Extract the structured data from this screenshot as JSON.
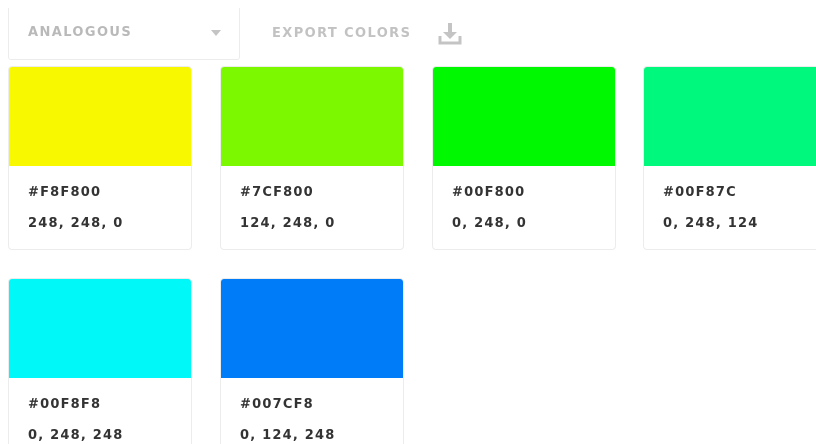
{
  "toolbar": {
    "scheme_select": {
      "selected": "ANALOGOUS",
      "caret_icon": "caret-down-icon"
    },
    "export": {
      "label": "EXPORT COLORS",
      "icon": "download-icon"
    }
  },
  "palette": [
    {
      "hex": "#F8F800",
      "rgb": "248, 248, 0"
    },
    {
      "hex": "#7CF800",
      "rgb": "124, 248, 0"
    },
    {
      "hex": "#00F800",
      "rgb": "0, 248, 0"
    },
    {
      "hex": "#00F87C",
      "rgb": "0, 248, 124"
    },
    {
      "hex": "#00F8F8",
      "rgb": "0, 248, 248"
    },
    {
      "hex": "#007CF8",
      "rgb": "0, 124, 248"
    }
  ],
  "colors": {
    "muted_text": "#b9b9b9",
    "value_text": "#333333",
    "card_border": "#ececec"
  }
}
